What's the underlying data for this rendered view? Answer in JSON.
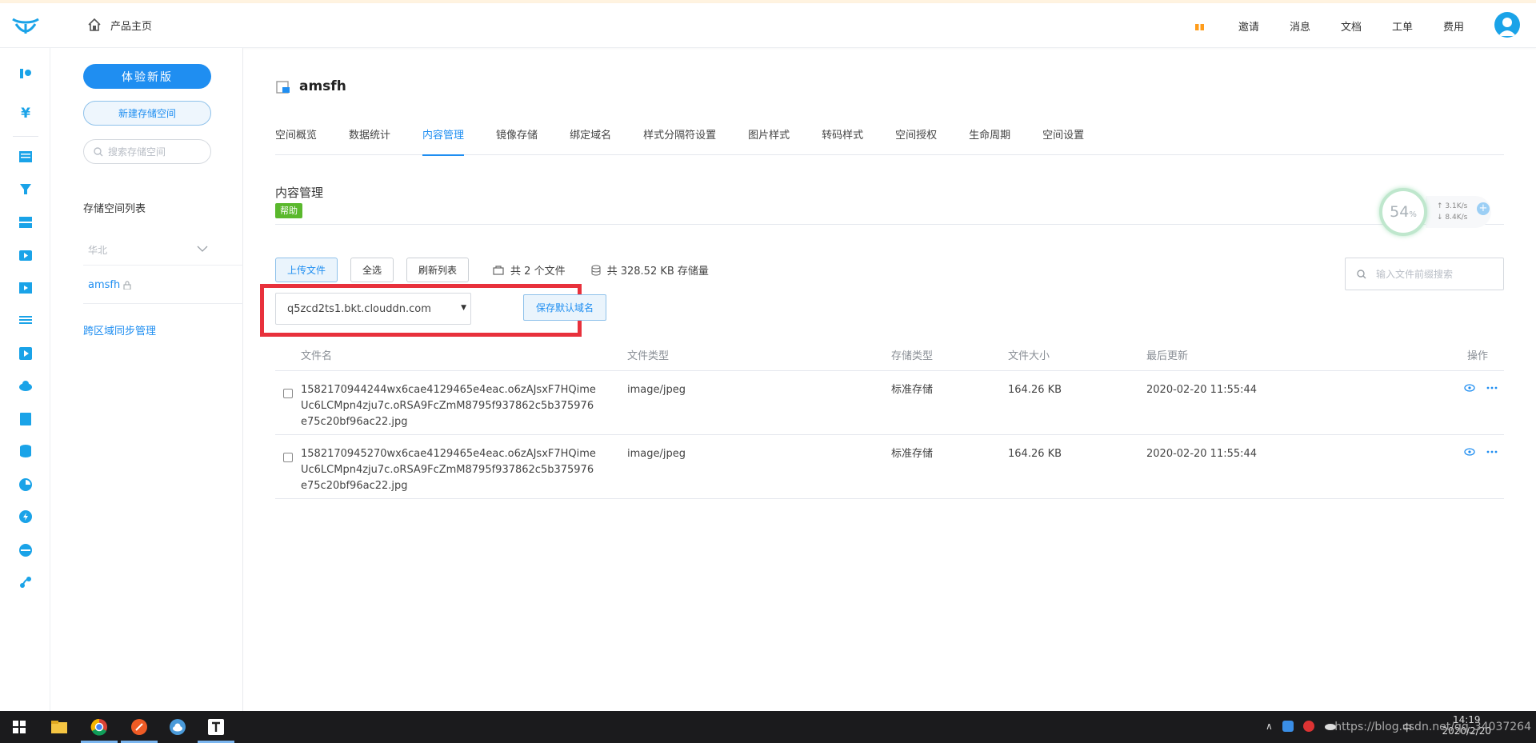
{
  "topbar": {
    "home_label": "产品主页",
    "nav": [
      "邀请",
      "消息",
      "文档",
      "工单",
      "费用"
    ]
  },
  "sidebar": {
    "new_version_button": "体验新版",
    "create_bucket_button": "新建存储空间",
    "search_placeholder": "搜索存储空间",
    "list_title": "存储空间列表",
    "region": "华北",
    "bucket_name": "amsfh",
    "cross_region_link": "跨区域同步管理"
  },
  "main": {
    "bucket_title": "amsfh",
    "tabs": [
      "空间概览",
      "数据统计",
      "内容管理",
      "镜像存储",
      "绑定域名",
      "样式分隔符设置",
      "图片样式",
      "转码样式",
      "空间授权",
      "生命周期",
      "空间设置"
    ],
    "active_tab": "内容管理",
    "section_title": "内容管理",
    "help_badge": "帮助",
    "widget": {
      "percent": "54",
      "percent_unit": "%",
      "up_speed": "3.1K/s",
      "down_speed": "8.4K/s"
    },
    "toolbar": {
      "upload": "上传文件",
      "select_all": "全选",
      "refresh": "刷新列表",
      "file_count": "共 2 个文件",
      "storage_total": "共 328.52 KB 存储量"
    },
    "search_placeholder": "输入文件前缀搜索",
    "domain_select_value": "q5zcd2ts1.bkt.clouddn.com",
    "save_domain_button": "保存默认域名",
    "table": {
      "headers": [
        "文件名",
        "文件类型",
        "存储类型",
        "文件大小",
        "最后更新",
        "操作"
      ],
      "rows": [
        {
          "name": "1582170944244wx6cae4129465e4eac.o6zAJsxF7HQimeUc6LCMpn4zju7c.oRSA9FcZmM8795f937862c5b375976e75c20bf96ac22.jpg",
          "type": "image/jpeg",
          "storage": "标准存储",
          "size": "164.26 KB",
          "updated": "2020-02-20 11:55:44"
        },
        {
          "name": "1582170945270wx6cae4129465e4eac.o6zAJsxF7HQimeUc6LCMpn4zju7c.oRSA9FcZmM8795f937862c5b375976e75c20bf96ac22.jpg",
          "type": "image/jpeg",
          "storage": "标准存储",
          "size": "164.26 KB",
          "updated": "2020-02-20 11:55:44"
        }
      ]
    }
  },
  "taskbar": {
    "time": "14:19",
    "date": "2020/2/20",
    "ime": "中",
    "watermark": "https://blog.csdn.net/qq_34037264"
  },
  "colors": {
    "accent": "#1f8ef1",
    "help_green": "#5ab82d",
    "highlight_red": "#e8313c",
    "invite_orange": "#ff9c1a"
  }
}
